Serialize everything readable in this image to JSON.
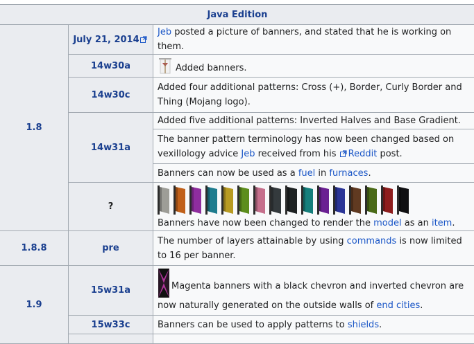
{
  "header": {
    "title": "Java Edition"
  },
  "rows": {
    "v18": {
      "version": "1.8",
      "date_snapshot": "July 21, 2014",
      "date_text_link": "Jeb",
      "date_text_rest": " posted a picture of banners, and stated that he is working on them.",
      "s1": {
        "name": "14w30a",
        "text": "Added banners."
      },
      "s2": {
        "name": "14w30c",
        "text": "Added four additional patterns: Cross (+), Border, Curly Border and Thing (Mojang logo)."
      },
      "s3": {
        "name": "14w31a",
        "line1": "Added five additional patterns: Inverted Halves and Base Gradient.",
        "line2_a": "The banner pattern terminology has now been changed based on vexillology advice ",
        "line2_link1": "Jeb",
        "line2_b": " received from his ",
        "line2_link2": "Reddit",
        "line2_c": " post.",
        "line3_a": "Banners can now be used as a ",
        "line3_link1": "fuel",
        "line3_b": " in ",
        "line3_link2": "furnaces",
        "line3_c": "."
      },
      "s4": {
        "name": "?",
        "text_a": "Banners have now been changed to render the ",
        "text_link1": "model",
        "text_b": " as an ",
        "text_link2": "item",
        "text_c": "."
      }
    },
    "v188": {
      "version": "1.8.8",
      "snapshot": "pre",
      "text_a": "The number of layers attainable by using ",
      "text_link": "commands",
      "text_b": " is now limited to 16 per banner."
    },
    "v19": {
      "version": "1.9",
      "s1": {
        "name": "15w31a",
        "text_a": "Magenta banners with a black chevron and inverted chevron are now naturally generated on the outside walls of ",
        "text_link": "end cities",
        "text_b": "."
      },
      "s2": {
        "name": "15w33c",
        "text_a": "Banners can be used to apply patterns to ",
        "text_link": "shields",
        "text_b": "."
      }
    }
  },
  "banner_colors": [
    "#9d9d97",
    "#c0601a",
    "#8f2d9e",
    "#1e7c8e",
    "#b89b22",
    "#5c8d1c",
    "#c56f8c",
    "#343a3d",
    "#1d2122",
    "#157f7c",
    "#6a1f92",
    "#2b3597",
    "#603a21",
    "#4a6a17",
    "#8e1d1d",
    "#101012"
  ],
  "icons": [
    "external-link-icon",
    "banner-icon",
    "magenta-chevron-banner-icon"
  ],
  "colors": {
    "link": "#1a56c7",
    "header_text": "#1a3f8f",
    "header_bg": "#eaecf0",
    "cell_bg": "#f8f9fa",
    "border": "#a2a9b1"
  }
}
